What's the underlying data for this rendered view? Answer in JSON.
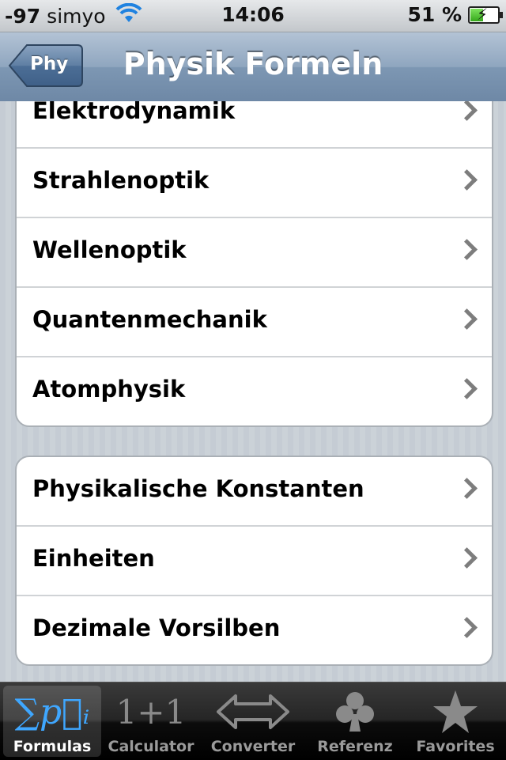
{
  "status_bar": {
    "signal": "-97",
    "carrier": "simyo",
    "time": "14:06",
    "battery": "51 %",
    "battery_level": 0.51
  },
  "nav": {
    "back_label": "Phy",
    "title": "Physik Formeln"
  },
  "groups": [
    {
      "items": [
        {
          "label": "Elektrodynamik"
        },
        {
          "label": "Strahlenoptik"
        },
        {
          "label": "Wellenoptik"
        },
        {
          "label": "Quantenmechanik"
        },
        {
          "label": "Atomphysik"
        }
      ]
    },
    {
      "items": [
        {
          "label": "Physikalische Konstanten"
        },
        {
          "label": "Einheiten"
        },
        {
          "label": "Dezimale Vorsilben"
        }
      ]
    }
  ],
  "tabs": [
    {
      "label": "Formulas",
      "icon": "sum-formula-icon",
      "active": true,
      "glyph": "∑p⃗ᵢ"
    },
    {
      "label": "Calculator",
      "icon": "one-plus-one-icon",
      "active": false,
      "glyph": "1+1"
    },
    {
      "label": "Converter",
      "icon": "double-arrow-icon",
      "active": false
    },
    {
      "label": "Referenz",
      "icon": "club-icon",
      "active": false
    },
    {
      "label": "Favorites",
      "icon": "star-icon",
      "active": false
    }
  ],
  "colors": {
    "accent_active": "#3fa7ff",
    "nav_bar": "#7d97b3"
  }
}
